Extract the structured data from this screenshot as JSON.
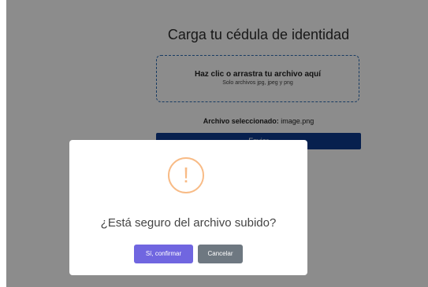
{
  "page": {
    "title": "Carga tu cédula de identidad",
    "dropzone": {
      "main": "Haz clic o arrastra tu archivo aquí",
      "hint": "Solo archivos jpg, jpeg y png"
    },
    "selected_label": "Archivo seleccionado:",
    "selected_file": "image.png",
    "submit_label": "Enviar"
  },
  "dialog": {
    "icon": "exclamation-icon",
    "icon_glyph": "!",
    "title": "¿Está seguro del archivo subido?",
    "confirm_label": "Sí, confirmar",
    "cancel_label": "Cancelar"
  },
  "colors": {
    "primary": "#0d3b8e",
    "confirm": "#7066e0",
    "cancel": "#6e7881",
    "warning": "#f8bb86"
  }
}
